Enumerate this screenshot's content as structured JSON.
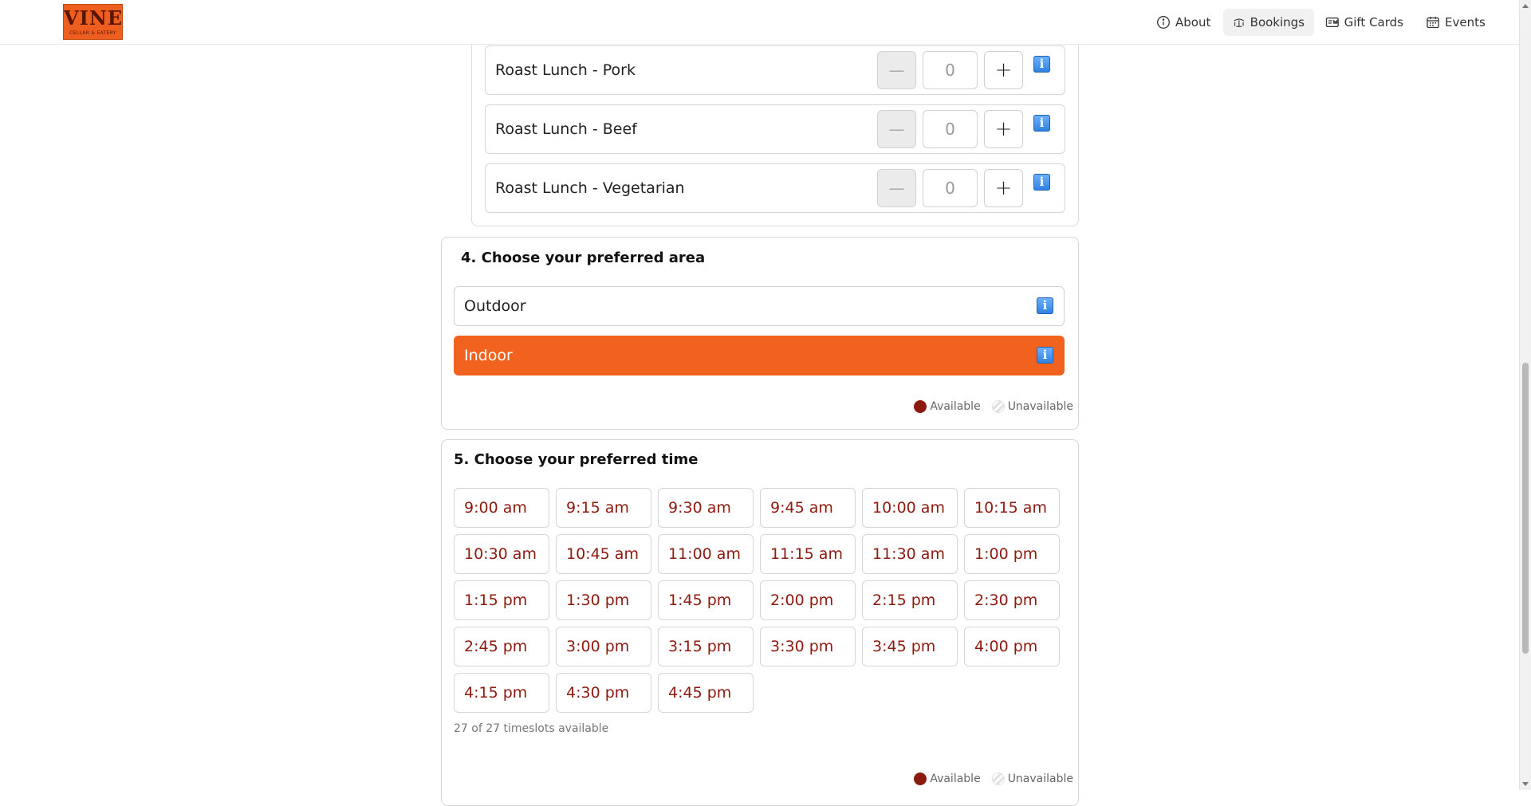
{
  "header": {
    "logo": {
      "mark": "VINE",
      "sub": "CELLAR & EATERY"
    },
    "nav": [
      {
        "label": "About",
        "icon": "info-circle-icon",
        "active": false
      },
      {
        "label": "Bookings",
        "icon": "table-icon",
        "active": true
      },
      {
        "label": "Gift Cards",
        "icon": "gift-card-icon",
        "active": false
      },
      {
        "label": "Events",
        "icon": "calendar-icon",
        "active": false
      }
    ]
  },
  "menu_items": [
    {
      "name": "Roast Lunch - Pork",
      "count": "0",
      "minus": "—",
      "plus": "+"
    },
    {
      "name": "Roast Lunch - Beef",
      "count": "0",
      "minus": "—",
      "plus": "+"
    },
    {
      "name": "Roast Lunch - Vegetarian",
      "count": "0",
      "minus": "—",
      "plus": "+"
    }
  ],
  "area": {
    "title": "4. Choose your preferred area",
    "options": [
      {
        "label": "Outdoor",
        "selected": false
      },
      {
        "label": "Indoor",
        "selected": true
      }
    ],
    "legend": {
      "available": "Available",
      "unavailable": "Unavailable"
    }
  },
  "time": {
    "title": "5. Choose your preferred time",
    "slots": [
      "9:00 am",
      "9:15 am",
      "9:30 am",
      "9:45 am",
      "10:00 am",
      "10:15 am",
      "10:30 am",
      "10:45 am",
      "11:00 am",
      "11:15 am",
      "11:30 am",
      "1:00 pm",
      "1:15 pm",
      "1:30 pm",
      "1:45 pm",
      "2:00 pm",
      "2:15 pm",
      "2:30 pm",
      "2:45 pm",
      "3:00 pm",
      "3:15 pm",
      "3:30 pm",
      "3:45 pm",
      "4:00 pm",
      "4:15 pm",
      "4:30 pm",
      "4:45 pm"
    ],
    "availability_text": "27 of 27 timeslots available",
    "legend": {
      "available": "Available",
      "unavailable": "Unavailable"
    }
  },
  "info_glyph": "i",
  "colors": {
    "brand": "#f1621e",
    "available": "#8d1a0e",
    "slot_text": "#8d1a0e",
    "info": "#2e7fe0"
  }
}
